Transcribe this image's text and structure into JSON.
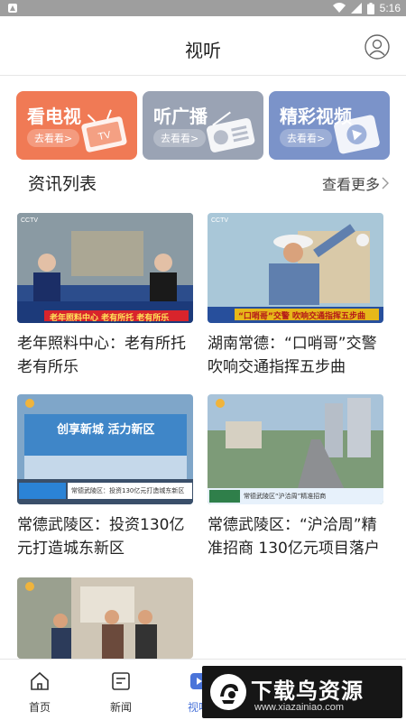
{
  "status_bar": {
    "time": "5:16"
  },
  "header": {
    "title": "视听"
  },
  "tiles": [
    {
      "label": "看电视",
      "button": "去看看>",
      "color": "#f07a55"
    },
    {
      "label": "听广播",
      "button": "去看看>",
      "color": "#9aa3b4"
    },
    {
      "label": "精彩视频",
      "button": "去看看>",
      "color": "#7b93c9"
    }
  ],
  "section": {
    "title": "资讯列表",
    "more": "查看更多"
  },
  "cards": [
    {
      "caption": "老年照料中心：老有所托 老有所乐",
      "overlay": "老年照料中心 老有所托 老有所乐"
    },
    {
      "caption": "湖南常德：“口哨哥”交警 吹响交通指挥五步曲",
      "overlay": "“口哨哥”交警 吹响交通指挥五步曲"
    },
    {
      "caption": "常德武陵区：投资130亿元打造城东新区",
      "overlay": "常德武陵区：投资130亿元打造城东新区",
      "banner": "创享新城 活力新区"
    },
    {
      "caption": "常德武陵区：“沪洽周”精准招商 130亿元项目落户",
      "overlay": "常德武陵区“沪洽周”精准招商"
    },
    {
      "caption": "",
      "overlay": ""
    }
  ],
  "nav": [
    {
      "label": "首页"
    },
    {
      "label": "新闻"
    },
    {
      "label": "视听"
    }
  ],
  "watermark": {
    "name": "下载鸟资源",
    "url": "www.xiazainiao.com"
  },
  "colors": {
    "accent": "#4a74d9",
    "divider": "#e6e6e6"
  }
}
